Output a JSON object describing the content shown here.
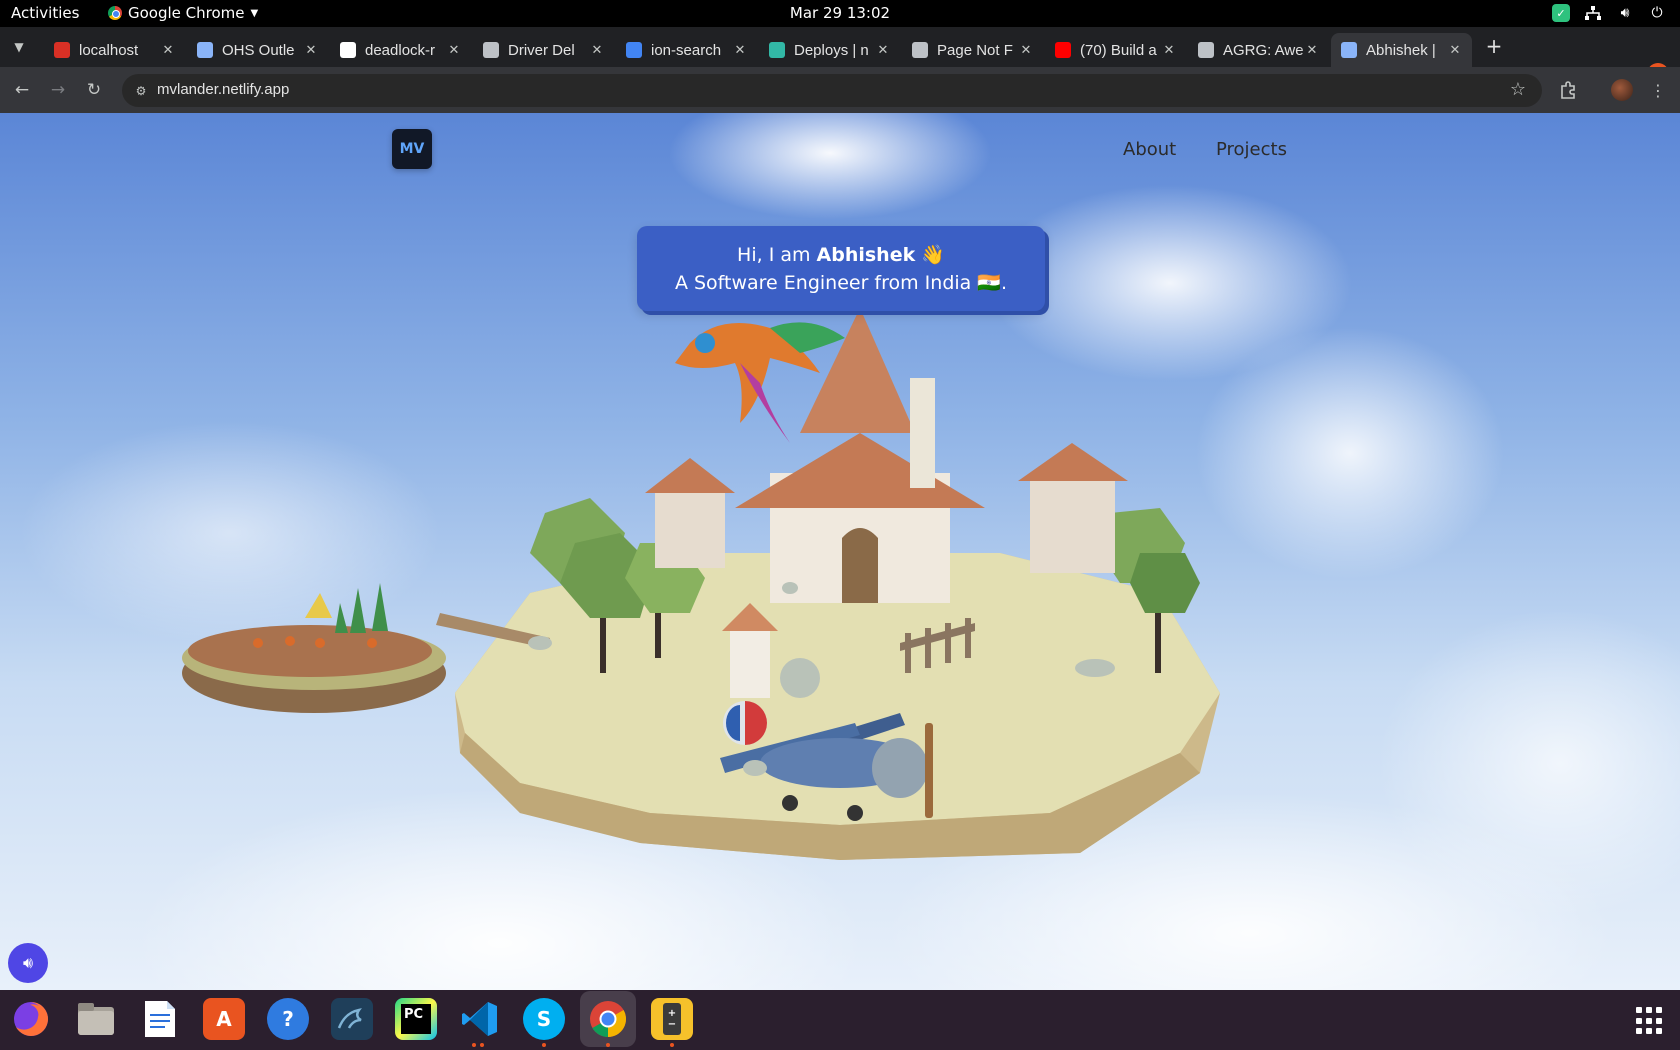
{
  "system_bar": {
    "activities": "Activities",
    "app_name": "Google Chrome",
    "clock": "Mar 29  13:02"
  },
  "browser": {
    "tabs": [
      {
        "label": "localhost",
        "fav_color": "#d93025"
      },
      {
        "label": "OHS Outle",
        "fav_color": "#8ab4f8"
      },
      {
        "label": "deadlock-r",
        "fav_color": "#ffffff"
      },
      {
        "label": "Driver Del",
        "fav_color": "#bdc1c6"
      },
      {
        "label": "ion-search",
        "fav_color": "#4285f4"
      },
      {
        "label": "Deploys | n",
        "fav_color": "#32b8a6"
      },
      {
        "label": "Page Not F",
        "fav_color": "#bdc1c6"
      },
      {
        "label": "(70) Build a",
        "fav_color": "#ff0000"
      },
      {
        "label": "AGRG: Awe",
        "fav_color": "#bdc1c6"
      },
      {
        "label": "Abhishek |",
        "fav_color": "#8ab4f8",
        "active": true
      }
    ],
    "url": "mvlander.netlify.app"
  },
  "page": {
    "logo": "MV",
    "nav": {
      "about": "About",
      "projects": "Projects"
    },
    "intro": {
      "greeting_prefix": "Hi, I am ",
      "name": "Abhishek",
      "wave": "👋",
      "line2": "A Software Engineer from India 🇮🇳."
    },
    "colors": {
      "accent": "#3b5fc5",
      "sound_button": "#4f46e5",
      "logo_text": "#60a5fa"
    }
  },
  "dock": {
    "apps": [
      "firefox-icon",
      "files-icon",
      "writer-icon",
      "app-center-icon",
      "help-icon",
      "mysql-workbench-icon",
      "pycharm-icon",
      "vscode-icon",
      "skype-icon",
      "chrome-icon",
      "calculator-icon"
    ]
  }
}
